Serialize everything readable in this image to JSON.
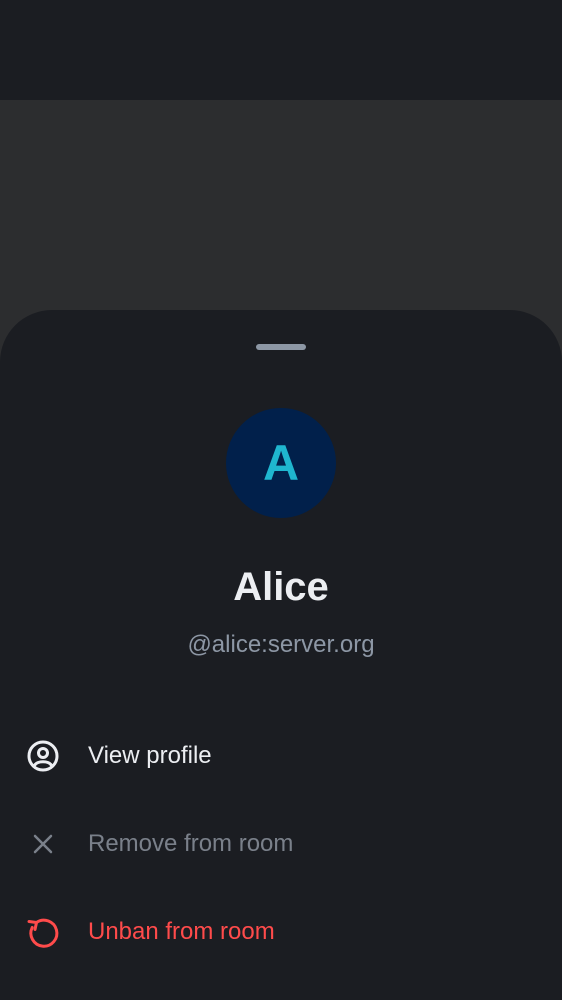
{
  "member": {
    "avatar_initial": "A",
    "display_name": "Alice",
    "user_id": "@alice:server.org"
  },
  "actions": [
    {
      "label": "View profile",
      "icon": "user-profile-icon",
      "state": "enabled"
    },
    {
      "label": "Remove from room",
      "icon": "close-icon",
      "state": "disabled"
    },
    {
      "label": "Unban from room",
      "icon": "restore-icon",
      "state": "destructive"
    }
  ],
  "colors": {
    "background": "#1b1d22",
    "scrim": "#2c2d2f",
    "avatar_bg": "#01204b",
    "avatar_text": "#1fb6cf",
    "primary_text": "#eceef2",
    "secondary_text": "#8d97a5",
    "disabled_text": "#7a808a",
    "critical": "#ff4b4b"
  }
}
